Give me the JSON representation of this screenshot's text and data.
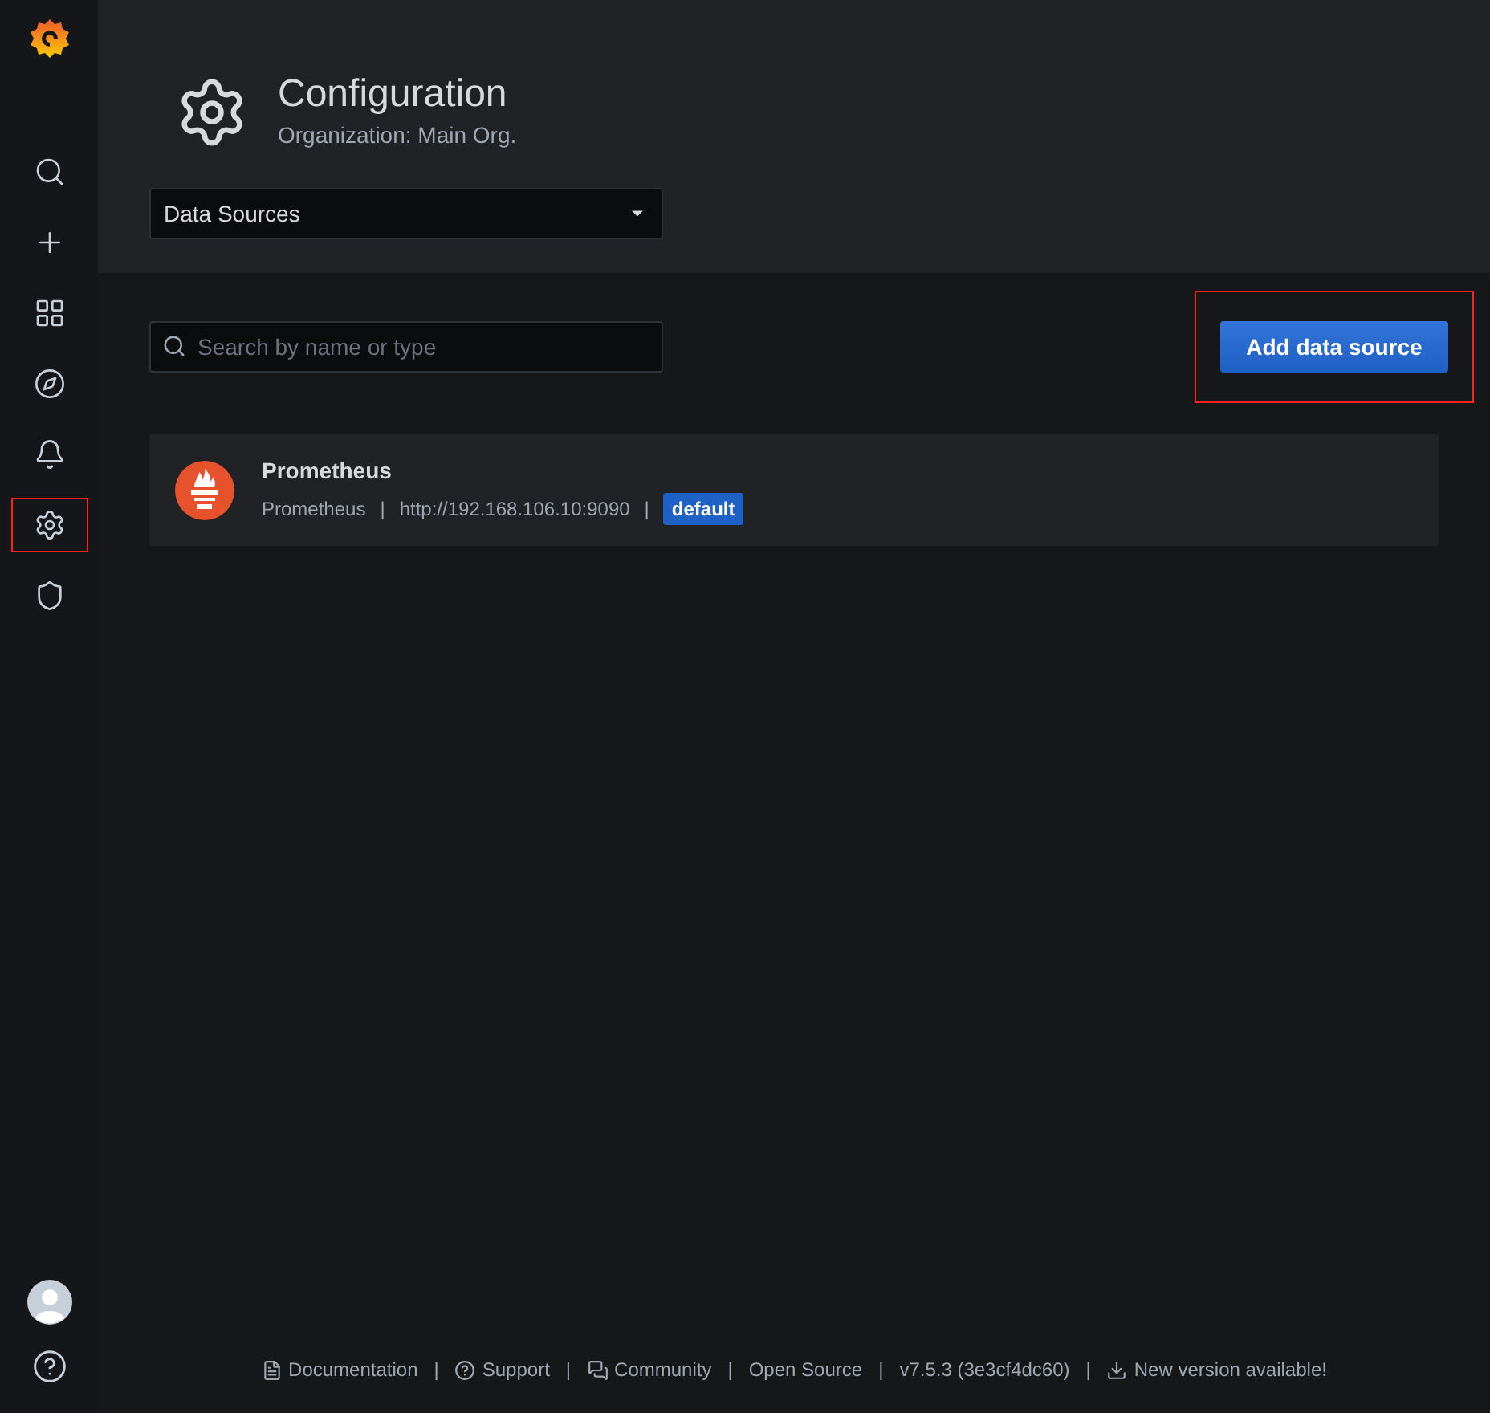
{
  "sidebar": {
    "items": [
      {
        "kind": "search",
        "highlighted": false
      },
      {
        "kind": "plus",
        "highlighted": false
      },
      {
        "kind": "grid",
        "highlighted": false
      },
      {
        "kind": "compass",
        "highlighted": false
      },
      {
        "kind": "bell",
        "highlighted": false
      },
      {
        "kind": "gear",
        "highlighted": true
      },
      {
        "kind": "shield",
        "highlighted": false
      }
    ],
    "bottom_items": [
      {
        "kind": "avatar"
      },
      {
        "kind": "help"
      }
    ]
  },
  "header": {
    "title": "Configuration",
    "subtitle": "Organization: Main Org.",
    "dropdown": "Data Sources"
  },
  "search": {
    "placeholder": "Search by name or type"
  },
  "add_button": {
    "label": "Add data source",
    "highlighted": true
  },
  "datasources": [
    {
      "name": "Prometheus",
      "type": "Prometheus",
      "url": "http://192.168.106.10:9090",
      "badge": "default"
    }
  ],
  "footer": [
    {
      "kind": "doc",
      "label": "Documentation"
    },
    {
      "kind": "help",
      "label": "Support"
    },
    {
      "kind": "chat",
      "label": "Community"
    },
    {
      "kind": "none",
      "label": "Open Source"
    },
    {
      "kind": "none",
      "label": "v7.5.3 (3e3cf4dc60)"
    },
    {
      "kind": "download",
      "label": "New version available!"
    }
  ],
  "footer_separator": "|"
}
